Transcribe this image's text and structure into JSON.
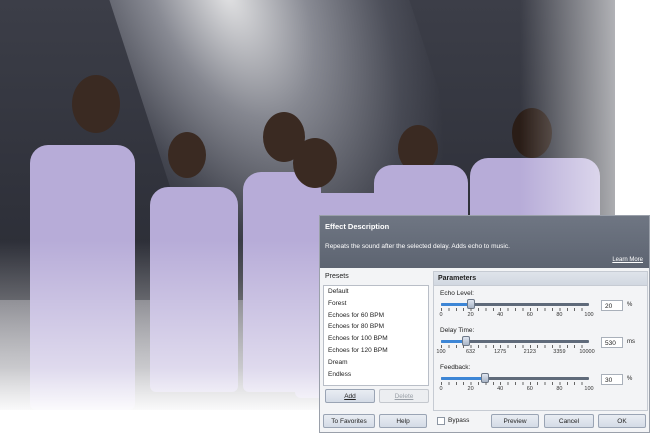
{
  "effect": {
    "title": "Effect Description",
    "description": "Repeats the sound after the selected delay. Adds echo to music.",
    "learn_more": "Learn More"
  },
  "presets": {
    "header": "Presets",
    "items": [
      "Default",
      "Forest",
      "Echoes for 60 BPM",
      "Echoes for 80 BPM",
      "Echoes for 100 BPM",
      "Echoes for 120 BPM",
      "Dream",
      "Endless"
    ],
    "add": "Add",
    "delete": "Delete"
  },
  "parameters": {
    "header": "Parameters",
    "echo_level": {
      "label": "Echo Level:",
      "value": "20",
      "unit": "%",
      "fraction": 0.2,
      "scale": [
        "0",
        "20",
        "40",
        "60",
        "80",
        "100"
      ]
    },
    "delay_time": {
      "label": "Delay Time:",
      "value": "530",
      "unit": "ms",
      "fraction": 0.17,
      "scale": [
        "100",
        "632",
        "1275",
        "2123",
        "3359",
        "10000"
      ]
    },
    "feedback": {
      "label": "Feedback:",
      "value": "30",
      "unit": "%",
      "fraction": 0.3,
      "scale": [
        "0",
        "20",
        "40",
        "60",
        "80",
        "100"
      ]
    }
  },
  "footer": {
    "to_favorites": "To Favorites",
    "help": "Help",
    "bypass": "Bypass",
    "preview": "Preview",
    "cancel": "Cancel",
    "ok": "OK"
  },
  "colors": {
    "accent": "#3d86d6",
    "header_bg": "#626a77",
    "outfit": "#b7acd8"
  }
}
